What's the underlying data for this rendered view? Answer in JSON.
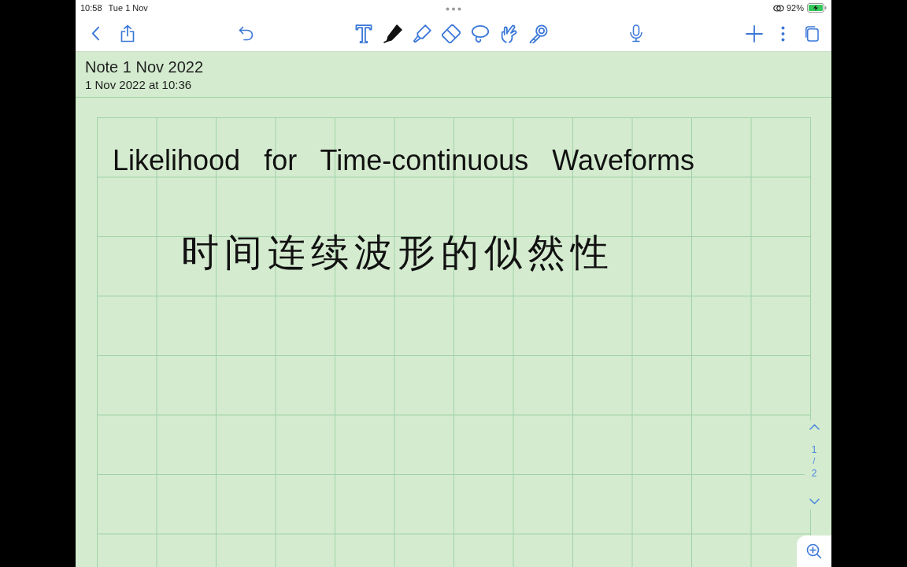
{
  "status_bar": {
    "time": "10:58",
    "date": "Tue 1 Nov",
    "battery": "92%"
  },
  "tools": [
    {
      "kind": "text",
      "selected": false
    },
    {
      "kind": "pen",
      "selected": true
    },
    {
      "kind": "highlighter",
      "selected": false
    },
    {
      "kind": "eraser",
      "selected": false
    },
    {
      "kind": "lasso",
      "selected": false
    },
    {
      "kind": "hand",
      "selected": false
    },
    {
      "kind": "wand",
      "selected": false
    }
  ],
  "note": {
    "title": "Note 1 Nov 2022",
    "date": "1 Nov 2022 at 10:36"
  },
  "handwriting": [
    "Likelihood for Time-continuous Waveforms",
    "时间连续波形的似然性"
  ],
  "page_indicator": {
    "current": "1",
    "separator": "/",
    "total": "2"
  }
}
